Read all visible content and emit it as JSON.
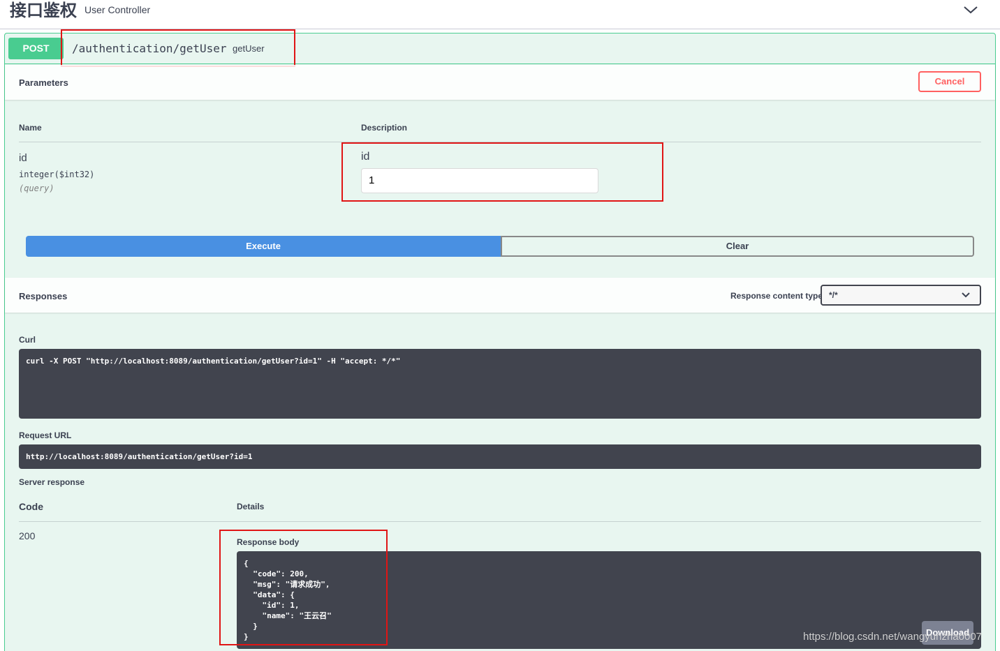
{
  "tag": {
    "name": "接口鉴权",
    "description": "User Controller",
    "collapse_icon": "chevron-down-icon"
  },
  "operation": {
    "method": "POST",
    "path": "/authentication/getUser",
    "operation_id": "getUser"
  },
  "parameters": {
    "title": "Parameters",
    "cancel_label": "Cancel",
    "col_name": "Name",
    "col_description": "Description",
    "items": [
      {
        "name": "id",
        "type": "integer($int32)",
        "in": "(query)",
        "description": "id",
        "value": "1"
      }
    ]
  },
  "actions": {
    "execute_label": "Execute",
    "clear_label": "Clear"
  },
  "responses": {
    "title": "Responses",
    "content_type_label": "Response content type",
    "content_type_value": "*/*",
    "curl_label": "Curl",
    "curl_command": "curl -X POST \"http://localhost:8089/authentication/getUser?id=1\" -H \"accept: */*\"",
    "request_url_label": "Request URL",
    "request_url": "http://localhost:8089/authentication/getUser?id=1",
    "server_response_label": "Server response",
    "code_header": "Code",
    "details_header": "Details",
    "code": "200",
    "response_body_label": "Response body",
    "response_body": "{\n  \"code\": 200,\n  \"msg\": \"请求成功\",\n  \"data\": {\n    \"id\": 1,\n    \"name\": \"王云召\"\n  }\n}",
    "download_label": "Download"
  },
  "watermark": "https://blog.csdn.net/wangyunzhao007",
  "colors": {
    "post": "#49cc90",
    "execute": "#4990e2",
    "cancel": "#ff6060",
    "code_bg": "#41444e",
    "highlight_box": "#e01515"
  }
}
